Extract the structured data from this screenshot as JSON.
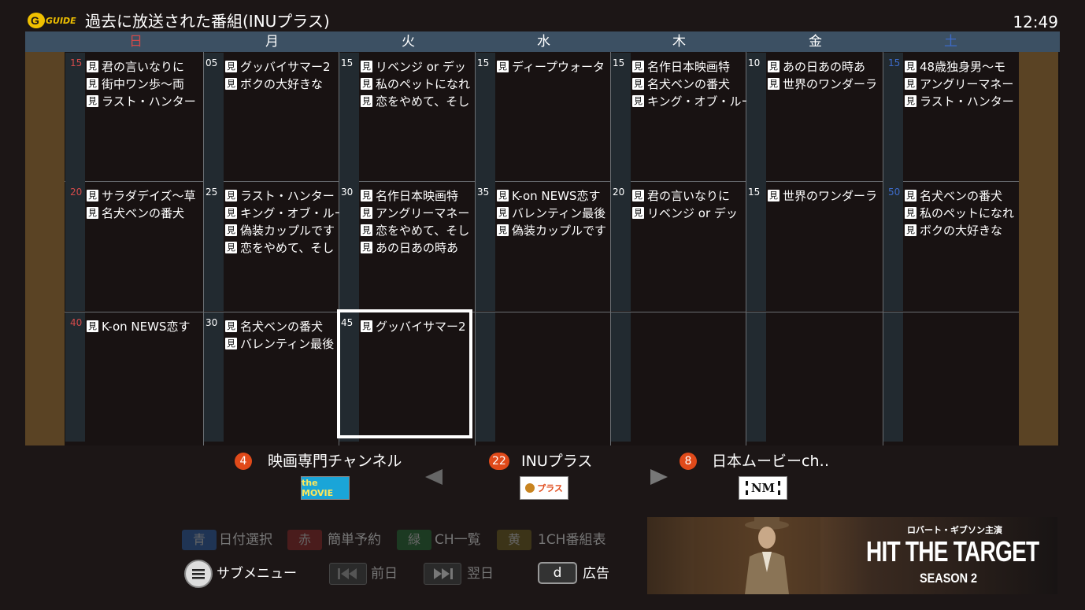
{
  "header": {
    "logo_text": "GUIDE",
    "title": "過去に放送された番組(INUプラス)",
    "clock": "12:49"
  },
  "days": [
    "日",
    "月",
    "火",
    "水",
    "木",
    "金",
    "土"
  ],
  "colors": {
    "sunday": "#d24a4a",
    "saturday": "#3d6bc9",
    "accent": "#e04a1a"
  },
  "program_icon": "見",
  "hour_labels": {
    "row0": "15",
    "row1": "20",
    "row2": "40",
    "row1_sat": "50"
  },
  "grid": [
    [
      {
        "minute": "",
        "hour": "15",
        "programs": [
          "君の言いなりに",
          "街中ワン歩～両",
          "ラスト・ハンター"
        ]
      },
      {
        "minute": "05",
        "programs": [
          "グッバイサマー2",
          "ボクの大好きな"
        ]
      },
      {
        "minute": "15",
        "programs": [
          "リベンジ or デッ",
          "私のペットになれ",
          "恋をやめて、そし"
        ]
      },
      {
        "minute": "15",
        "programs": [
          "ディープウォータ"
        ]
      },
      {
        "minute": "15",
        "programs": [
          "名作日本映画特",
          "名犬ベンの番犬",
          "キング・オブ・ルー"
        ]
      },
      {
        "minute": "10",
        "programs": [
          "あの日あの時あ",
          "世界のワンダーラ"
        ]
      },
      {
        "minute": "",
        "hour": "15",
        "sat": true,
        "programs": [
          "48歳独身男～モ",
          "アングリーマネー",
          "ラスト・ハンター"
        ]
      }
    ],
    [
      {
        "minute": "",
        "hour": "20",
        "programs": [
          "サラダデイズ～草",
          "名犬ベンの番犬"
        ]
      },
      {
        "minute": "25",
        "programs": [
          "ラスト・ハンター",
          "キング・オブ・ルー",
          "偽装カップルです",
          "恋をやめて、そし"
        ]
      },
      {
        "minute": "30",
        "programs": [
          "名作日本映画特",
          "アングリーマネー",
          "恋をやめて、そし",
          "あの日あの時あ"
        ]
      },
      {
        "minute": "35",
        "programs": [
          "K-on NEWS恋す",
          "バレンティン最後",
          "偽装カップルです"
        ]
      },
      {
        "minute": "20",
        "programs": [
          "君の言いなりに",
          "リベンジ or デッ"
        ]
      },
      {
        "minute": "15",
        "programs": [
          "世界のワンダーラ"
        ]
      },
      {
        "minute": "",
        "hour": "50",
        "sat": true,
        "programs": [
          "名犬ベンの番犬",
          "私のペットになれ",
          "ボクの大好きな"
        ]
      }
    ],
    [
      {
        "minute": "",
        "hour": "40",
        "programs": [
          "K-on NEWS恋す"
        ]
      },
      {
        "minute": "30",
        "programs": [
          "名犬ベンの番犬",
          "バレンティン最後"
        ]
      },
      {
        "minute": "45",
        "programs": [
          "グッバイサマー2"
        ]
      },
      {
        "minute": "",
        "programs": []
      },
      {
        "minute": "",
        "programs": []
      },
      {
        "minute": "",
        "programs": []
      },
      {
        "minute": "",
        "programs": []
      }
    ]
  ],
  "channels": {
    "prev": {
      "number": "4",
      "name": "映画専門チャンネル",
      "logo": "the MOVIE"
    },
    "current": {
      "number": "22",
      "name": "INUプラス",
      "logo": "プラス"
    },
    "next": {
      "number": "8",
      "name": "日本ムービーch‥",
      "logo": "NM"
    }
  },
  "color_keys": [
    {
      "key": "青",
      "label": "日付選択",
      "color": "#1f3454"
    },
    {
      "key": "赤",
      "label": "簡単予約",
      "color": "#4a1c1c"
    },
    {
      "key": "緑",
      "label": "CH一覧",
      "color": "#1c3a22"
    },
    {
      "key": "黄",
      "label": "1CH番組表",
      "color": "#3c3418"
    }
  ],
  "controls": {
    "submenu_label": "サブメニュー",
    "prev_day_label": "前日",
    "next_day_label": "翌日",
    "d_key": "d",
    "ad_label": "広告"
  },
  "ad": {
    "tagline": "ロバート・ギブソン主演",
    "title": "HIT THE TARGET",
    "subtitle": "SEASON 2"
  }
}
